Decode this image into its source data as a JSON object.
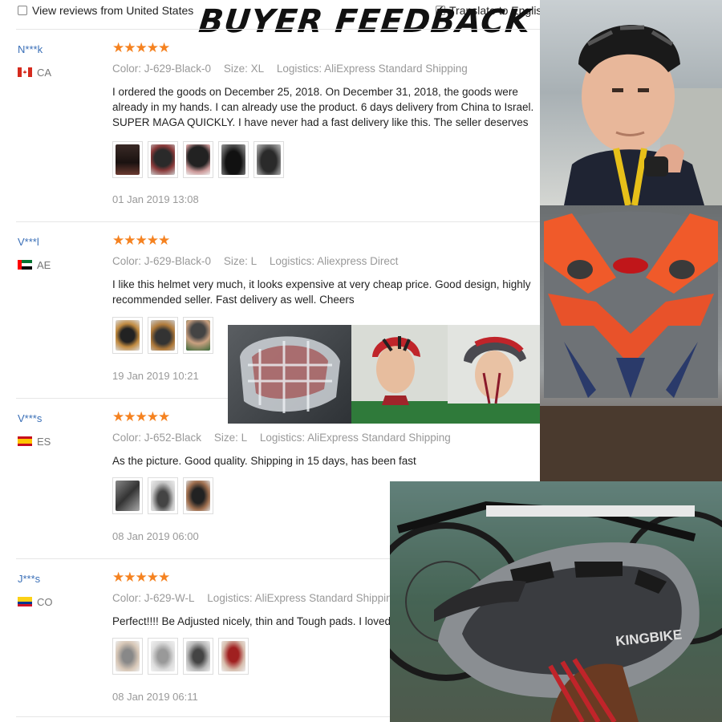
{
  "header": {
    "view_reviews_label": "View reviews from United States",
    "translate_label": "Translate to English",
    "title": "BUYER FEEDBACK"
  },
  "reviews": [
    {
      "user": "N***k",
      "country": "CA",
      "stars": "★★★★★",
      "color": "Color: J-629-Black-0",
      "size": "Size: XL",
      "logistics": "Logistics: AliExpress Standard Shipping",
      "text": "I ordered the goods on December 25, 2018. On December 31, 2018, the goods were already in my hands. I can already use the product. 6 days delivery from China to Israel. SUPER MAGA QUICKLY. I have never had a fast delivery like this. The seller deserves attention !!!! I think that I will order a large batch of goods. Recommend !!!!!!!!!!!!!!!",
      "date": "01 Jan 2019 13:08",
      "thumb_count": 5
    },
    {
      "user": "V***l",
      "country": "AE",
      "stars": "★★★★★",
      "color": "Color: J-629-Black-0",
      "size": "Size: L",
      "logistics": "Logistics: Aliexpress Direct",
      "text": "I like this helmet very much, it looks expensive at very cheap price. Good design, highly recommended seller. Fast delivery as well. Cheers",
      "date": "19 Jan 2019 10:21",
      "thumb_count": 3
    },
    {
      "user": "V***s",
      "country": "ES",
      "stars": "★★★★★",
      "color": "Color: J-652-Black",
      "size": "Size: L",
      "logistics": "Logistics: AliExpress Standard Shipping",
      "text": "As the picture. Good quality. Shipping in 15 days, has been fast",
      "date": "08 Jan 2019 06:00",
      "thumb_count": 3
    },
    {
      "user": "J***s",
      "country": "CO",
      "stars": "★★★★★",
      "color": "Color: J-629-W-L",
      "size": "",
      "logistics": "Logistics: AliExpress Standard Shipping",
      "text": "Perfect!!!! Be Adjusted nicely, thin and Tough pads. I loved it. Thanks",
      "date": "08 Jan 2019 06:11",
      "thumb_count": 4
    }
  ],
  "brand_text": "KINGBIKE"
}
